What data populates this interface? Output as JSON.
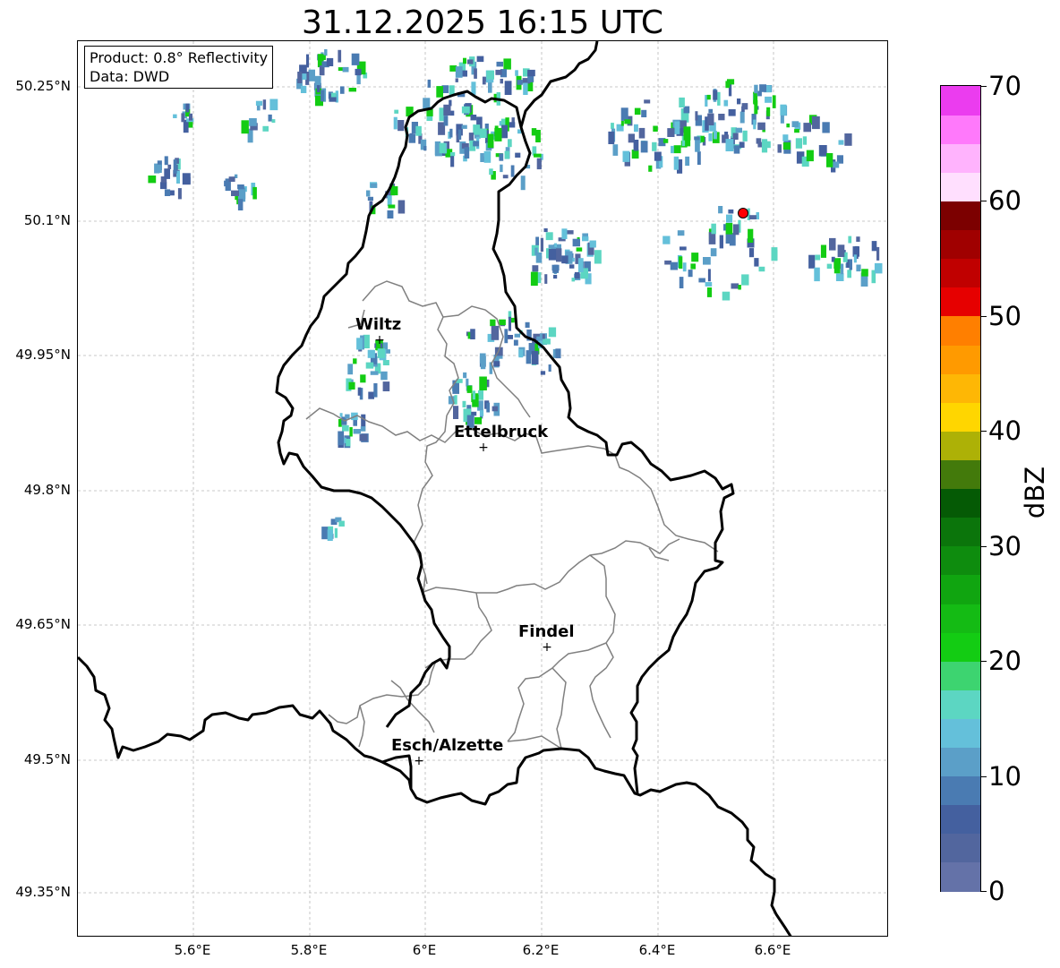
{
  "title": "31.12.2025 16:15 UTC",
  "info_box": {
    "product": "Product: 0.8° Reflectivity",
    "data_source": "Data: DWD"
  },
  "axes": {
    "lat_labels": [
      "50.25°N",
      "50.1°N",
      "49.95°N",
      "49.8°N",
      "49.65°N",
      "49.5°N",
      "49.35°N"
    ],
    "lon_labels": [
      "5.6°E",
      "5.8°E",
      "6°E",
      "6.2°E",
      "6.4°E",
      "6.6°E"
    ]
  },
  "cities": [
    {
      "name": "Wiltz"
    },
    {
      "name": "Ettelbruck"
    },
    {
      "name": "Findel"
    },
    {
      "name": "Esch/Alzette"
    }
  ],
  "radar_site_color": "#ff0000",
  "colorbar": {
    "label": "dBZ",
    "ticks": [
      "0",
      "10",
      "20",
      "30",
      "40",
      "50",
      "60",
      "70"
    ],
    "colors": [
      "#6472a8",
      "#52669e",
      "#44609f",
      "#4a7bb2",
      "#5b9fc8",
      "#64c0da",
      "#5cd6c2",
      "#3dd470",
      "#13cc13",
      "#14bb14",
      "#10a510",
      "#0e8c0e",
      "#0b750b",
      "#055a05",
      "#437a0b",
      "#adb106",
      "#ffd600",
      "#feb705",
      "#ff9a00",
      "#ff7f00",
      "#e60000",
      "#c00000",
      "#a00000",
      "#7c0000",
      "#ffdffe",
      "#ffb3fd",
      "#ff79fb",
      "#eb3cef"
    ]
  }
}
